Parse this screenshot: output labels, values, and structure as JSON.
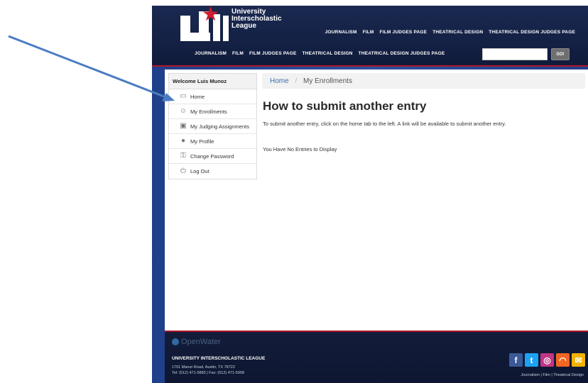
{
  "header": {
    "org_name": [
      "University",
      "Interscholastic",
      "League"
    ],
    "top_nav": [
      "JOURNALISM",
      "FILM",
      "FILM JUDGES PAGE",
      "THEATRICAL DESIGN",
      "THEATRICAL DESIGN JUDGES PAGE"
    ],
    "main_nav": [
      "JOURNALISM",
      "FILM",
      "FILM JUDGES PAGE",
      "THEATRICAL DESIGN",
      "THEATRICAL DESIGN JUDGES PAGE"
    ],
    "search_button": "GO!",
    "search_value": ""
  },
  "sidebar": {
    "welcome": "Welcome Luis Munoz",
    "items": [
      {
        "label": "Home",
        "icon": "home-icon"
      },
      {
        "label": "My Enrollments",
        "icon": "user-icon"
      },
      {
        "label": "My Judging Assignments",
        "icon": "clipboard-icon"
      },
      {
        "label": "My Profile",
        "icon": "profile-icon"
      },
      {
        "label": "Change Password",
        "icon": "key-icon"
      },
      {
        "label": "Log Out",
        "icon": "power-icon"
      }
    ]
  },
  "breadcrumb": {
    "home": "Home",
    "separator": "/",
    "current": "My Enrollments"
  },
  "main": {
    "title": "How to submit another entry",
    "instructions": "To submit another entry, click on the home tab to the left. A link will be available to submit another entry.",
    "empty_message": "You Have No Entries to Display"
  },
  "footer": {
    "provider": "OpenWater",
    "org": "UNIVERSITY INTERSCHOLASTIC LEAGUE",
    "address_line1": "1701 Manor Road, Austin, TX 78722",
    "address_line2": "Tel: (512) 471-5883 | Fax: (512) 471-5908",
    "links": "Journalism | Film | Theatrical Design",
    "social": [
      {
        "name": "facebook-icon",
        "glyph": "f",
        "color": "#3b5998"
      },
      {
        "name": "twitter-icon",
        "glyph": "t",
        "color": "#1da1f2"
      },
      {
        "name": "instagram-icon",
        "glyph": "◎",
        "color": "#c13584"
      },
      {
        "name": "rss-icon",
        "glyph": "◠",
        "color": "#f26522"
      },
      {
        "name": "email-icon",
        "glyph": "✉",
        "color": "#f3b300"
      }
    ]
  },
  "colors": {
    "frame_blue": "#2c4f9c",
    "header_navy": "#142145",
    "accent_red": "#b0162b",
    "link_blue": "#3a6fb0",
    "arrow_blue": "#4a7cc2"
  }
}
